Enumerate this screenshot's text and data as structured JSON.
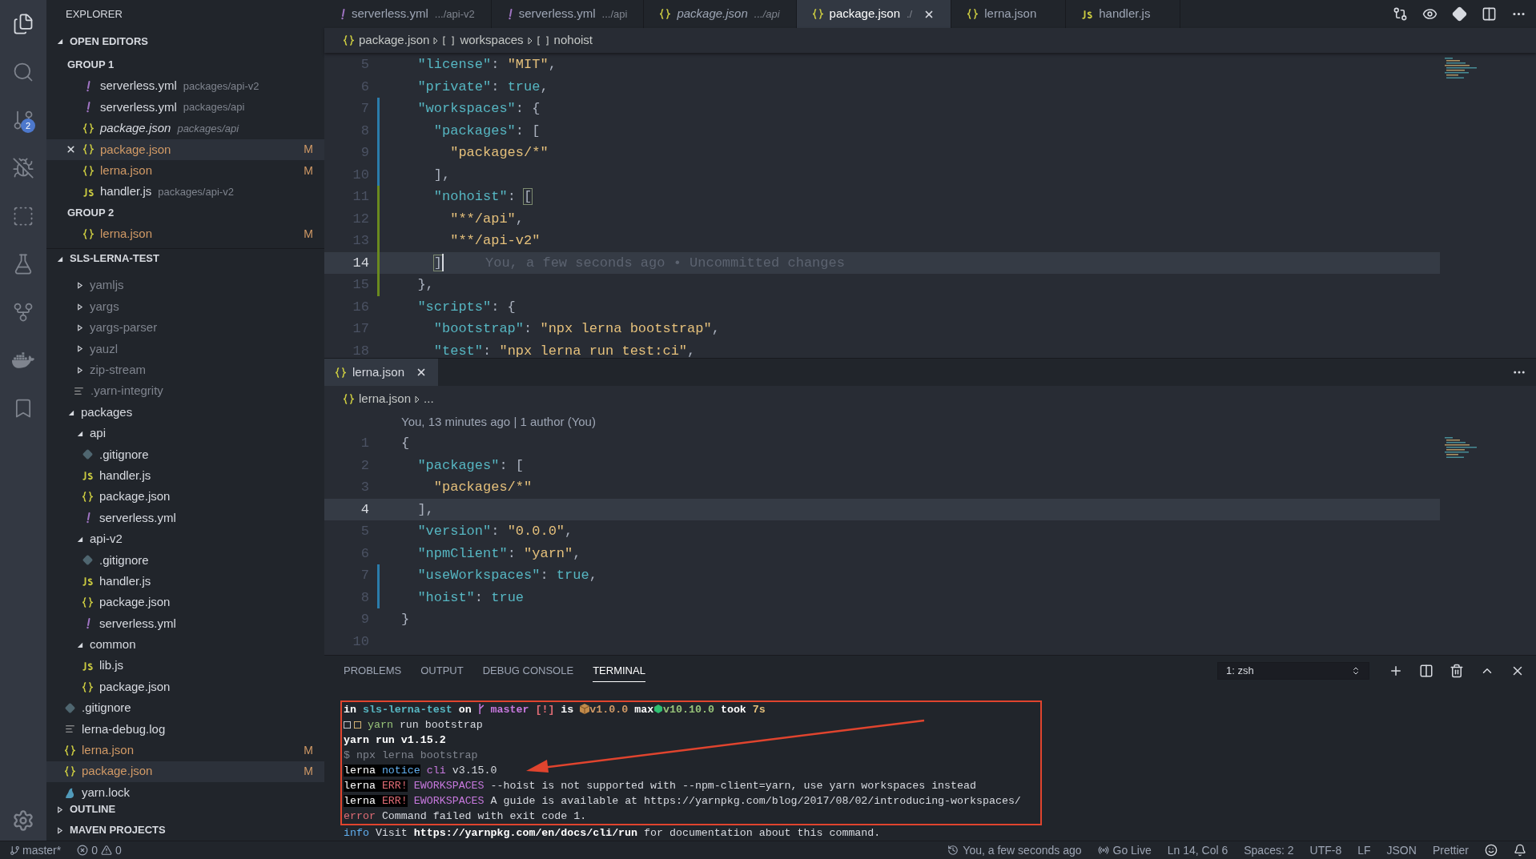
{
  "activity_bar": {
    "items": [
      {
        "kind": "files",
        "selected": true
      },
      {
        "kind": "search",
        "selected": false
      },
      {
        "kind": "source-control",
        "selected": false,
        "badge": "2"
      },
      {
        "kind": "debug",
        "selected": false
      },
      {
        "kind": "extensions",
        "selected": false
      },
      {
        "kind": "flask",
        "selected": false
      },
      {
        "kind": "history",
        "selected": false
      },
      {
        "kind": "docker",
        "selected": false
      },
      {
        "kind": "bookmark",
        "selected": false
      }
    ]
  },
  "sidebar": {
    "title": "EXPLORER",
    "open_editors": {
      "title": "OPEN EDITORS",
      "expanded": true,
      "groups": [
        {
          "title": "GROUP 1",
          "items": [
            {
              "kind": "yaml",
              "name": "serverless.yml",
              "path": "packages/api-v2",
              "italic": false,
              "selected": false
            },
            {
              "kind": "yaml",
              "name": "serverless.yml",
              "path": "packages/api",
              "italic": false,
              "selected": false
            },
            {
              "kind": "json",
              "name": "package.json",
              "path": "packages/api",
              "italic": true,
              "selected": false
            },
            {
              "kind": "json",
              "name": "package.json",
              "italic": false,
              "selected": true,
              "status": "M"
            },
            {
              "kind": "json",
              "name": "lerna.json",
              "italic": false,
              "selected": false,
              "status": "M"
            },
            {
              "kind": "js",
              "name": "handler.js",
              "path": "packages/api-v2",
              "italic": false,
              "selected": false
            }
          ]
        },
        {
          "title": "GROUP 2",
          "items": [
            {
              "kind": "json",
              "name": "lerna.json",
              "italic": false,
              "selected": false,
              "status": "M"
            }
          ]
        }
      ]
    },
    "project": {
      "title": "SLS-LERNA-TEST",
      "expanded": true,
      "tree": [
        {
          "kind": "scrolled_parent",
          "children": [
            {
              "kind": "folder",
              "name": "yamljs",
              "expanded": false,
              "ignored": true
            },
            {
              "kind": "folder",
              "name": "yargs",
              "expanded": false,
              "ignored": true
            },
            {
              "kind": "folder",
              "name": "yargs-parser",
              "expanded": false,
              "ignored": true
            },
            {
              "kind": "folder",
              "name": "yauzl",
              "expanded": false,
              "ignored": true
            },
            {
              "kind": "folder",
              "name": "zip-stream",
              "expanded": false,
              "ignored": true
            },
            {
              "kind": "text",
              "name": ".yarn-integrity",
              "ignored": true
            }
          ]
        },
        {
          "kind": "folder",
          "name": "packages",
          "expanded": true,
          "children": [
            {
              "kind": "folder",
              "name": "api",
              "expanded": true,
              "children": [
                {
                  "kind": "git",
                  "name": ".gitignore"
                },
                {
                  "kind": "js",
                  "name": "handler.js"
                },
                {
                  "kind": "json",
                  "name": "package.json"
                },
                {
                  "kind": "yaml",
                  "name": "serverless.yml"
                }
              ]
            },
            {
              "kind": "folder",
              "name": "api-v2",
              "expanded": true,
              "children": [
                {
                  "kind": "git",
                  "name": ".gitignore"
                },
                {
                  "kind": "js",
                  "name": "handler.js"
                },
                {
                  "kind": "json",
                  "name": "package.json"
                },
                {
                  "kind": "yaml",
                  "name": "serverless.yml"
                }
              ]
            },
            {
              "kind": "folder",
              "name": "common",
              "expanded": true,
              "children": [
                {
                  "kind": "js",
                  "name": "lib.js"
                },
                {
                  "kind": "json",
                  "name": "package.json"
                }
              ]
            }
          ]
        },
        {
          "kind": "git",
          "name": ".gitignore"
        },
        {
          "kind": "text",
          "name": "lerna-debug.log"
        },
        {
          "kind": "json",
          "name": "lerna.json",
          "status": "M"
        },
        {
          "kind": "json",
          "name": "package.json",
          "status": "M",
          "selected": true
        },
        {
          "kind": "yarn",
          "name": "yarn.lock"
        }
      ]
    },
    "sections": [
      {
        "title": "OUTLINE",
        "expanded": false
      },
      {
        "title": "MAVEN PROJECTS",
        "expanded": false
      }
    ]
  },
  "tabs": [
    {
      "kind": "yaml",
      "name": "serverless.yml",
      "path": ".../api-v2",
      "italic": false,
      "selected": false
    },
    {
      "kind": "yaml",
      "name": "serverless.yml",
      "path": ".../api",
      "italic": false,
      "selected": false
    },
    {
      "kind": "json",
      "name": "package.json",
      "path": ".../api",
      "italic": true,
      "selected": false
    },
    {
      "kind": "json",
      "name": "package.json",
      "path": "./",
      "italic": false,
      "selected": true
    },
    {
      "kind": "json",
      "name": "lerna.json",
      "italic": false,
      "selected": false
    },
    {
      "kind": "js",
      "name": "handler.js",
      "italic": false,
      "selected": false
    }
  ],
  "top_editor": {
    "breadcrumb": [
      {
        "kind": "file",
        "label": "package.json"
      },
      {
        "kind": "array",
        "label": "workspaces"
      },
      {
        "kind": "array",
        "label": "nohoist"
      }
    ],
    "lines": [
      {
        "number": "5",
        "kind": "plain",
        "tokens": [
          {
            "kind": "key",
            "text": "  \"license\""
          },
          {
            "kind": "punc",
            "text": ": "
          },
          {
            "kind": "str",
            "text": "\"MIT\""
          },
          {
            "kind": "punc",
            "text": ","
          }
        ]
      },
      {
        "number": "6",
        "kind": "plain",
        "tokens": [
          {
            "kind": "key",
            "text": "  \"private\""
          },
          {
            "kind": "punc",
            "text": ": "
          },
          {
            "kind": "lit",
            "text": "true"
          },
          {
            "kind": "punc",
            "text": ","
          }
        ]
      },
      {
        "number": "7",
        "kind": "modified",
        "tokens": [
          {
            "kind": "key",
            "text": "  \"workspaces\""
          },
          {
            "kind": "punc",
            "text": ": {"
          }
        ]
      },
      {
        "number": "8",
        "kind": "modified",
        "tokens": [
          {
            "kind": "key",
            "text": "    \"packages\""
          },
          {
            "kind": "punc",
            "text": ": ["
          }
        ]
      },
      {
        "number": "9",
        "kind": "modified",
        "tokens": [
          {
            "kind": "str",
            "text": "      \"packages/*\""
          }
        ]
      },
      {
        "number": "10",
        "kind": "modified",
        "tokens": [
          {
            "kind": "punc",
            "text": "    ],"
          }
        ]
      },
      {
        "number": "11",
        "kind": "added",
        "tokens": [
          {
            "kind": "key",
            "text": "    \"nohoist\""
          },
          {
            "kind": "punc",
            "text": ": "
          },
          {
            "kind": "match",
            "text": "["
          }
        ]
      },
      {
        "number": "12",
        "kind": "added",
        "tokens": [
          {
            "kind": "str",
            "text": "      \"**/api\""
          },
          {
            "kind": "punc",
            "text": ","
          }
        ]
      },
      {
        "number": "13",
        "kind": "added",
        "tokens": [
          {
            "kind": "str",
            "text": "      \"**/api-v2\""
          }
        ]
      },
      {
        "number": "14",
        "kind": "added",
        "current": true,
        "cursor": true,
        "blame": "You, a few seconds ago • Uncommitted changes",
        "tokens": [
          {
            "kind": "match",
            "text": "    ]"
          }
        ]
      },
      {
        "number": "15",
        "kind": "added",
        "tokens": [
          {
            "kind": "punc",
            "text": "  },"
          }
        ]
      },
      {
        "number": "16",
        "kind": "plain",
        "tokens": [
          {
            "kind": "key",
            "text": "  \"scripts\""
          },
          {
            "kind": "punc",
            "text": ": {"
          }
        ]
      },
      {
        "number": "17",
        "kind": "plain",
        "tokens": [
          {
            "kind": "key",
            "text": "    \"bootstrap\""
          },
          {
            "kind": "punc",
            "text": ": "
          },
          {
            "kind": "str",
            "text": "\"npx lerna bootstrap\""
          },
          {
            "kind": "punc",
            "text": ","
          }
        ]
      },
      {
        "number": "18",
        "kind": "plain",
        "tokens": [
          {
            "kind": "key",
            "text": "    \"test\""
          },
          {
            "kind": "punc",
            "text": ": "
          },
          {
            "kind": "str",
            "text": "\"npx lerna run test:ci\""
          },
          {
            "kind": "punc",
            "text": ","
          }
        ]
      }
    ]
  },
  "bottom_editor": {
    "tab": {
      "kind": "json",
      "name": "lerna.json",
      "selected": true
    },
    "breadcrumb": [
      {
        "kind": "file",
        "label": "lerna.json"
      },
      {
        "kind": "more",
        "label": "..."
      }
    ],
    "codelens": "You, 13 minutes ago | 1 author (You)",
    "lines": [
      {
        "number": "1",
        "kind": "plain",
        "tokens": [
          {
            "kind": "punc",
            "text": "{"
          }
        ]
      },
      {
        "number": "2",
        "kind": "plain",
        "tokens": [
          {
            "kind": "key",
            "text": "  \"packages\""
          },
          {
            "kind": "punc",
            "text": ": ["
          }
        ]
      },
      {
        "number": "3",
        "kind": "plain",
        "tokens": [
          {
            "kind": "str",
            "text": "    \"packages/*\""
          }
        ]
      },
      {
        "number": "4",
        "kind": "plain",
        "current": true,
        "tokens": [
          {
            "kind": "punc",
            "text": "  ],"
          }
        ]
      },
      {
        "number": "5",
        "kind": "plain",
        "tokens": [
          {
            "kind": "key",
            "text": "  \"version\""
          },
          {
            "kind": "punc",
            "text": ": "
          },
          {
            "kind": "str",
            "text": "\"0.0.0\""
          },
          {
            "kind": "punc",
            "text": ","
          }
        ]
      },
      {
        "number": "6",
        "kind": "plain",
        "tokens": [
          {
            "kind": "key",
            "text": "  \"npmClient\""
          },
          {
            "kind": "punc",
            "text": ": "
          },
          {
            "kind": "str",
            "text": "\"yarn\""
          },
          {
            "kind": "punc",
            "text": ","
          }
        ]
      },
      {
        "number": "7",
        "kind": "modified",
        "tokens": [
          {
            "kind": "key",
            "text": "  \"useWorkspaces\""
          },
          {
            "kind": "punc",
            "text": ": "
          },
          {
            "kind": "lit",
            "text": "true"
          },
          {
            "kind": "punc",
            "text": ","
          }
        ]
      },
      {
        "number": "8",
        "kind": "modified",
        "tokens": [
          {
            "kind": "key",
            "text": "  \"hoist\""
          },
          {
            "kind": "punc",
            "text": ": "
          },
          {
            "kind": "lit",
            "text": "true"
          }
        ]
      },
      {
        "number": "9",
        "kind": "plain",
        "tokens": [
          {
            "kind": "punc",
            "text": "}"
          }
        ]
      },
      {
        "number": "10",
        "kind": "plain"
      }
    ]
  },
  "panel": {
    "tabs": [
      {
        "label": "PROBLEMS",
        "selected": false
      },
      {
        "label": "OUTPUT",
        "selected": false
      },
      {
        "label": "DEBUG CONSOLE",
        "selected": false
      },
      {
        "label": "TERMINAL",
        "selected": true
      }
    ],
    "terminal_select": "1: zsh",
    "terminal": [
      {
        "highlighted": true,
        "segments": [
          {
            "kind": "bold",
            "text": "in "
          },
          {
            "kind": "path",
            "text": "sls-lerna-test"
          },
          {
            "kind": "bold",
            "text": " on "
          },
          {
            "kind": "branch_icon"
          },
          {
            "kind": "branch",
            "text": " master"
          },
          {
            "kind": "warn",
            "text": " [!]"
          },
          {
            "kind": "bold",
            "text": " is "
          },
          {
            "kind": "package_icon"
          },
          {
            "kind": "pkg",
            "text": "v1.0.0"
          },
          {
            "kind": "bold",
            "text": " max"
          },
          {
            "kind": "hexagon_icon"
          },
          {
            "kind": "node",
            "text": "v10.10.0"
          },
          {
            "kind": "bold",
            "text": " took "
          },
          {
            "kind": "took",
            "text": "7s"
          }
        ]
      },
      {
        "highlighted": true,
        "segments": [
          {
            "kind": "square_icon"
          },
          {
            "kind": "accent_square_icon"
          },
          {
            "kind": "yarn",
            "text": " yarn"
          },
          {
            "kind": "plain",
            "text": " run bootstrap"
          }
        ]
      },
      {
        "highlighted": true,
        "segments": [
          {
            "kind": "bold",
            "text": "yarn run v1.15.2"
          }
        ]
      },
      {
        "highlighted": true,
        "segments": [
          {
            "kind": "dim",
            "text": "$ npx lerna bootstrap"
          }
        ]
      },
      {
        "highlighted": true,
        "segments": [
          {
            "kind": "label",
            "text": "lerna"
          },
          {
            "kind": "notice",
            "text": " notice"
          },
          {
            "kind": "cli",
            "text": " cli"
          },
          {
            "kind": "plain",
            "text": " v3.15.0"
          }
        ]
      },
      {
        "highlighted": true,
        "segments": [
          {
            "kind": "label",
            "text": "lerna"
          },
          {
            "kind": "err",
            "text": " ERR!"
          },
          {
            "kind": "code",
            "text": " EWORKSPACES"
          },
          {
            "kind": "plain",
            "text": " --hoist is not supported with --npm-client=yarn, use yarn workspaces instead"
          }
        ]
      },
      {
        "highlighted": true,
        "segments": [
          {
            "kind": "label",
            "text": "lerna"
          },
          {
            "kind": "err",
            "text": " ERR!"
          },
          {
            "kind": "code",
            "text": " EWORKSPACES"
          },
          {
            "kind": "plain",
            "text": " A guide is available at https://yarnpkg.com/blog/2017/08/02/introducing-workspaces/"
          }
        ]
      },
      {
        "highlighted": true,
        "segments": [
          {
            "kind": "error",
            "text": "error"
          },
          {
            "kind": "plain",
            "text": " Command failed with exit code 1."
          }
        ]
      },
      {
        "highlighted": false,
        "segments": [
          {
            "kind": "info",
            "text": "info"
          },
          {
            "kind": "plain",
            "text": " Visit "
          },
          {
            "kind": "bold",
            "text": "https://yarnpkg.com/en/docs/cli/run"
          },
          {
            "kind": "plain",
            "text": " for documentation about this command."
          }
        ]
      }
    ]
  },
  "status_bar": {
    "branch": "master*",
    "errors": "0",
    "warnings": "0",
    "right": [
      {
        "kind": "blame",
        "text": "You, a few seconds ago"
      },
      {
        "kind": "live",
        "text": "Go Live"
      },
      {
        "kind": "plain",
        "text": "Ln 14, Col 6"
      },
      {
        "kind": "plain",
        "text": "Spaces: 2"
      },
      {
        "kind": "plain",
        "text": "UTF-8"
      },
      {
        "kind": "plain",
        "text": "LF"
      },
      {
        "kind": "plain",
        "text": "JSON"
      },
      {
        "kind": "plain",
        "text": "Prettier"
      }
    ]
  }
}
